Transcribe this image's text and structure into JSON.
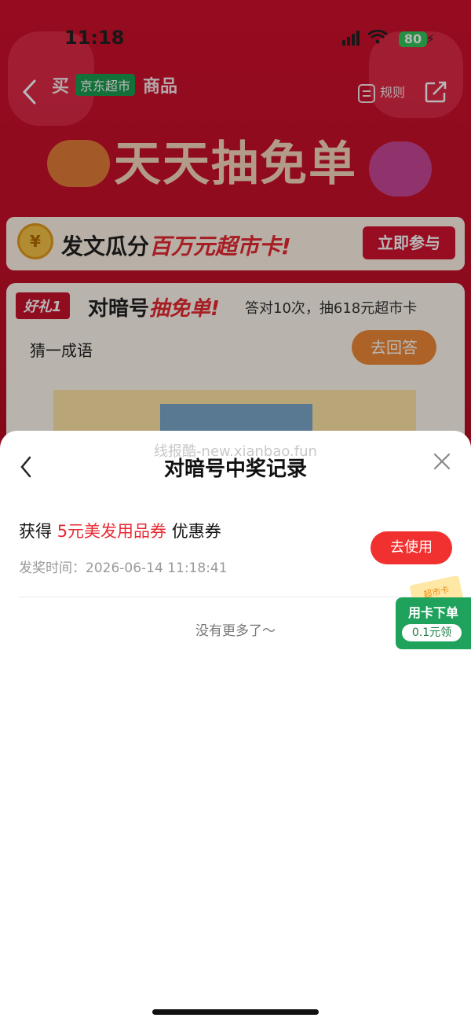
{
  "status_bar": {
    "time": "11:18",
    "battery": "80"
  },
  "header": {
    "title_left": "买",
    "badge": "京东超市",
    "title_right": "商品",
    "rules_label": "规则"
  },
  "banner": {
    "title": "天天抽免单"
  },
  "promo": {
    "text_prefix": "发文瓜分",
    "text_highlight": "百万元超市卡!",
    "button_label": "立即参与"
  },
  "card": {
    "badge": "好礼1",
    "title_prefix": "对暗号",
    "title_highlight": "抽免单!",
    "subtitle": "答对10次，抽618元超市卡",
    "riddle": "猜一成语",
    "answer_button": "去回答"
  },
  "sheet": {
    "watermark": "线报酷-new.xianbao.fun",
    "title": "对暗号中奖记录",
    "record": {
      "prefix": "获得",
      "prize": "5元美发用品券",
      "suffix": "优惠券",
      "time_label": "发奖时间：",
      "time_value": "2026-06-14 11:18:41",
      "use_button": "去使用"
    },
    "no_more": "没有更多了～"
  },
  "floating_card": {
    "ticket_label": "超市卡",
    "label": "用卡下单",
    "price": "0.1元领"
  },
  "colors": {
    "brand_red": "#c8122c",
    "accent_red": "#e82932",
    "button_red": "#f0312f",
    "green": "#1fa35c"
  }
}
